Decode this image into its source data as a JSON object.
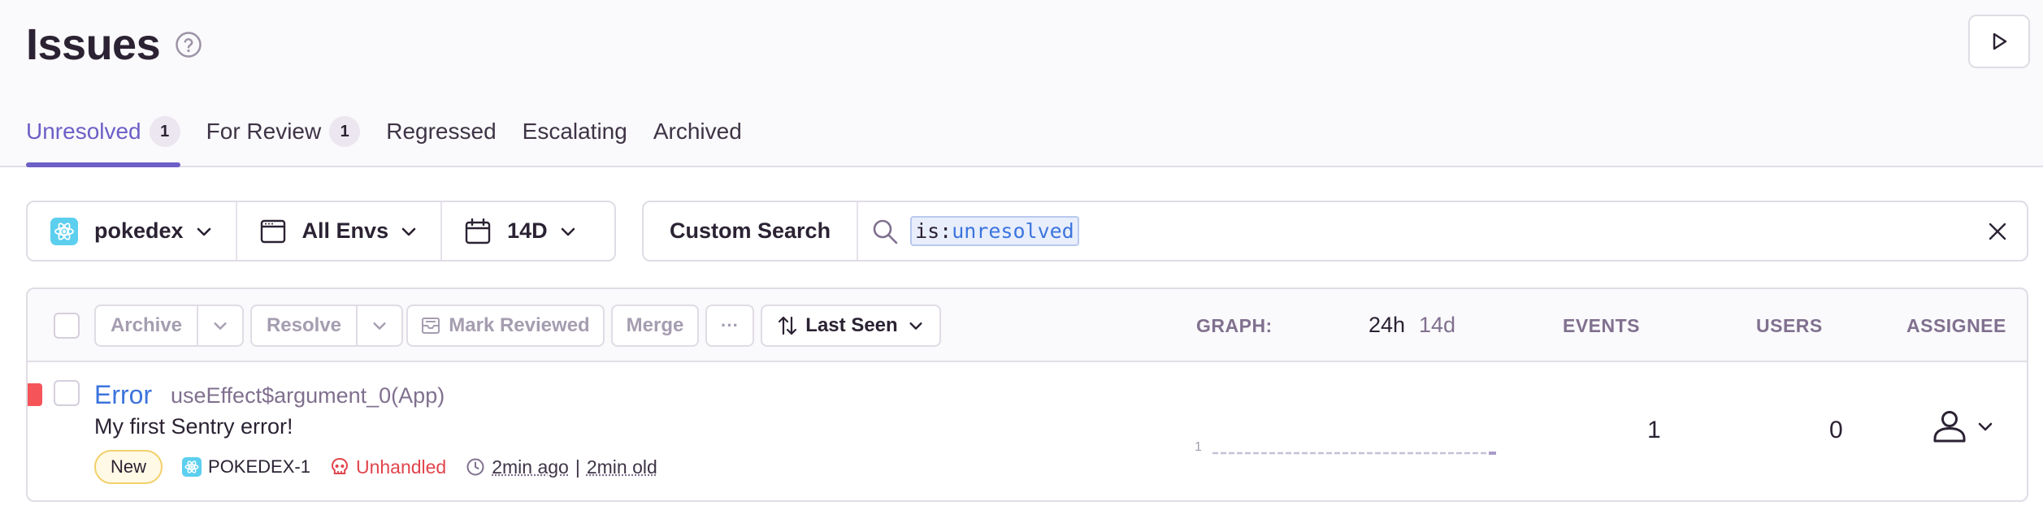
{
  "page": {
    "title": "Issues"
  },
  "tabs": [
    {
      "label": "Unresolved",
      "count": "1",
      "active": true
    },
    {
      "label": "For Review",
      "count": "1"
    },
    {
      "label": "Regressed"
    },
    {
      "label": "Escalating"
    },
    {
      "label": "Archived"
    }
  ],
  "filters": {
    "project": "pokedex",
    "environment": "All Envs",
    "date_range": "14D"
  },
  "search": {
    "custom_search_label": "Custom Search",
    "token_key": "is:",
    "token_value": "unresolved"
  },
  "toolbar": {
    "archive": "Archive",
    "resolve": "Resolve",
    "mark_reviewed": "Mark Reviewed",
    "merge": "Merge",
    "more": "···",
    "sort": "Last Seen"
  },
  "columns": {
    "graph": "GRAPH:",
    "graph_24h": "24h",
    "graph_14d": "14d",
    "events": "EVENTS",
    "users": "USERS",
    "assignee": "ASSIGNEE"
  },
  "issues": [
    {
      "type": "Error",
      "culprit": "useEffect$argument_0(App)",
      "message": "My first Sentry error!",
      "badge": "New",
      "short_id": "POKEDEX-1",
      "mechanism": "Unhandled",
      "last_seen": "2min ago",
      "first_seen": "2min old",
      "graph_max": "1",
      "events": "1",
      "users": "0"
    }
  ],
  "colors": {
    "accent": "#6c5fc7",
    "link": "#3c74dd",
    "error_level": "#f55459",
    "unhandled": "#e1444c"
  },
  "icons": [
    "question-circle-icon",
    "play-icon",
    "react-icon",
    "window-icon",
    "calendar-icon",
    "chevron-down-icon",
    "search-icon",
    "close-icon",
    "sort-icon",
    "skull-icon",
    "clock-icon",
    "user-icon",
    "mark-reviewed-icon"
  ]
}
